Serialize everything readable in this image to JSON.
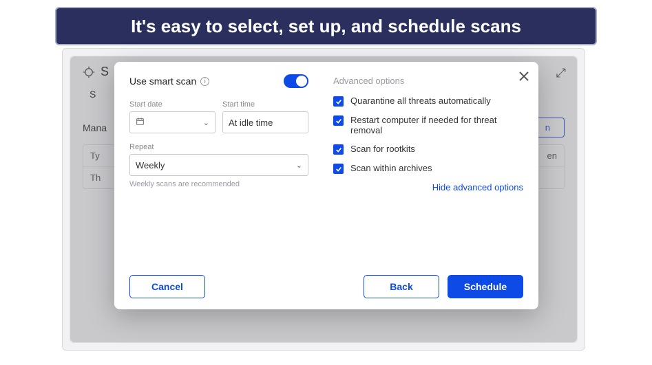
{
  "banner": {
    "text": "It's easy to select, set up, and schedule scans"
  },
  "background": {
    "title_initial": "S",
    "tab_initial": "S",
    "left_label": "Mana",
    "right_button_suffix": "n",
    "table_header_left": "Ty",
    "table_header_right": "en",
    "table_row_left": "Th"
  },
  "modal": {
    "smart_scan_label": "Use smart scan",
    "start_date_label": "Start date",
    "start_date_value": "",
    "start_time_label": "Start time",
    "start_time_value": "At idle time",
    "repeat_label": "Repeat",
    "repeat_value": "Weekly",
    "repeat_hint": "Weekly scans are recommended",
    "advanced_title": "Advanced options",
    "options": [
      "Quarantine all threats automatically",
      "Restart computer if needed for threat removal",
      "Scan for rootkits",
      "Scan within archives"
    ],
    "hide_advanced": "Hide advanced options",
    "cancel": "Cancel",
    "back": "Back",
    "schedule": "Schedule"
  }
}
